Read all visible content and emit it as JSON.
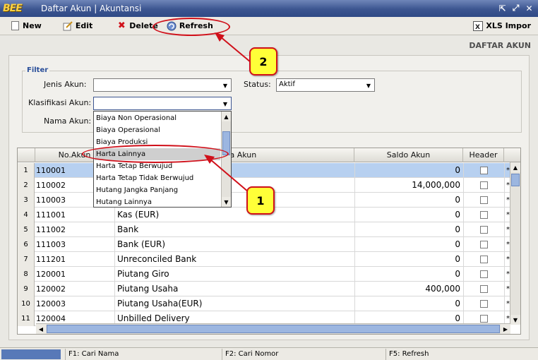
{
  "window": {
    "logo": "BEE",
    "title": "Daftar Akun | Akuntansi",
    "controls": [
      "restore-icon",
      "maximize-icon",
      "close-icon"
    ]
  },
  "toolbar": {
    "new": "New",
    "edit": "Edit",
    "delete": "Delete",
    "refresh": "Refresh",
    "xls": "XLS Impor"
  },
  "page_heading": "DAFTAR AKUN",
  "filter": {
    "title": "Filter",
    "jenis_label": "Jenis Akun:",
    "jenis_value": "",
    "status_label": "Status:",
    "status_value": "Aktif",
    "klasifikasi_label": "Klasifikasi Akun:",
    "klasifikasi_value": "",
    "nama_label": "Nama Akun:",
    "nama_value": ""
  },
  "dropdown": {
    "items": [
      "Biaya Non Operasional",
      "Biaya Operasional",
      "Biaya Produksi",
      "Harta Lainnya",
      "Harta Tetap Berwujud",
      "Harta Tetap Tidak Berwujud",
      "Hutang Jangka Panjang",
      "Hutang Lainnya"
    ],
    "hovered": "Harta Lainnya"
  },
  "grid": {
    "columns": [
      "No.Akun",
      "Nama Akun",
      "Saldo Akun",
      "Header"
    ],
    "rows": [
      {
        "n": "1",
        "no": "110001",
        "name": "",
        "saldo": "0"
      },
      {
        "n": "2",
        "no": "110002",
        "name": "",
        "saldo": "14,000,000"
      },
      {
        "n": "3",
        "no": "110003",
        "name": "",
        "saldo": "0"
      },
      {
        "n": "4",
        "no": "111001",
        "name": "Kas (EUR)",
        "saldo": "0"
      },
      {
        "n": "5",
        "no": "111002",
        "name": "Bank",
        "saldo": "0"
      },
      {
        "n": "6",
        "no": "111003",
        "name": "Bank (EUR)",
        "saldo": "0"
      },
      {
        "n": "7",
        "no": "111201",
        "name": "Unreconciled Bank",
        "saldo": "0"
      },
      {
        "n": "8",
        "no": "120001",
        "name": "Piutang Giro",
        "saldo": "0"
      },
      {
        "n": "9",
        "no": "120002",
        "name": "Piutang Usaha",
        "saldo": "400,000"
      },
      {
        "n": "10",
        "no": "120003",
        "name": "Piutang Usaha(EUR)",
        "saldo": "0"
      },
      {
        "n": "11",
        "no": "120004",
        "name": "Unbilled Delivery",
        "saldo": "0"
      }
    ],
    "star": "*"
  },
  "annotations": {
    "callout1": "1",
    "callout2": "2"
  },
  "statusbar": {
    "f1": "F1: Cari Nama",
    "f2": "F2: Cari Nomor",
    "f5": "F5: Refresh"
  }
}
